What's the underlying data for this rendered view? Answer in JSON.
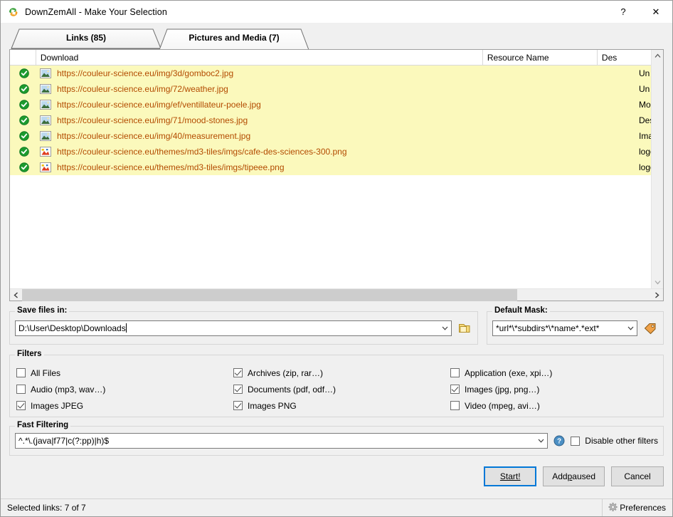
{
  "window": {
    "title": "DownZemAll - Make Your Selection",
    "app_icon": "downzemall-icon",
    "help_button": "?",
    "close_button": "✕"
  },
  "tabs": [
    {
      "label": "Links (85)",
      "name": "tab-links",
      "active": false
    },
    {
      "label": "Pictures and Media (7)",
      "name": "tab-pictures-and-media",
      "active": true
    }
  ],
  "list": {
    "columns": [
      {
        "key": "check",
        "label": ""
      },
      {
        "key": "download",
        "label": "Download"
      },
      {
        "key": "resource",
        "label": "Resource Name"
      },
      {
        "key": "description",
        "label": "Des"
      }
    ],
    "rows": [
      {
        "checked": true,
        "icon": "image-file-icon",
        "url": "https://couleur-science.eu/img/3d/gomboc2.jpg",
        "resource": "",
        "description": "Un"
      },
      {
        "checked": true,
        "icon": "image-file-icon",
        "url": "https://couleur-science.eu/img/72/weather.jpg",
        "resource": "",
        "description": "Un"
      },
      {
        "checked": true,
        "icon": "image-file-icon",
        "url": "https://couleur-science.eu/img/ef/ventillateur-poele.jpg",
        "resource": "",
        "description": "Mo"
      },
      {
        "checked": true,
        "icon": "image-file-icon",
        "url": "https://couleur-science.eu/img/71/mood-stones.jpg",
        "resource": "",
        "description": "Des"
      },
      {
        "checked": true,
        "icon": "image-file-icon",
        "url": "https://couleur-science.eu/img/40/measurement.jpg",
        "resource": "",
        "description": "Ima"
      },
      {
        "checked": true,
        "icon": "png-file-icon",
        "url": "https://couleur-science.eu/themes/md3-tiles/imgs/cafe-des-sciences-300.png",
        "resource": "",
        "description": "logo"
      },
      {
        "checked": true,
        "icon": "png-file-icon",
        "url": "https://couleur-science.eu/themes/md3-tiles/imgs/tipeee.png",
        "resource": "",
        "description": "logo"
      }
    ]
  },
  "save_files": {
    "group_title": "Save files in:",
    "path_value": "D:\\User\\Desktop\\Downloads",
    "browse_icon": "folder-icon"
  },
  "default_mask": {
    "group_title": "Default Mask:",
    "mask_value": "*url*\\*subdirs*\\*name*.*ext*",
    "tag_icon": "tag-icon"
  },
  "filters": {
    "group_title": "Filters",
    "items": [
      {
        "label": "All Files",
        "checked": false,
        "name": "filter-all-files"
      },
      {
        "label": "Archives (zip, rar…)",
        "checked": true,
        "name": "filter-archives"
      },
      {
        "label": "Application (exe, xpi…)",
        "checked": false,
        "name": "filter-application"
      },
      {
        "label": "Audio (mp3, wav…)",
        "checked": false,
        "name": "filter-audio"
      },
      {
        "label": "Documents (pdf, odf…)",
        "checked": true,
        "name": "filter-documents"
      },
      {
        "label": "Images (jpg, png…)",
        "checked": true,
        "name": "filter-images"
      },
      {
        "label": "Images JPEG",
        "checked": true,
        "name": "filter-images-jpeg"
      },
      {
        "label": "Images PNG",
        "checked": true,
        "name": "filter-images-png"
      },
      {
        "label": "Video (mpeg, avi…)",
        "checked": false,
        "name": "filter-video"
      }
    ]
  },
  "fast_filtering": {
    "group_title": "Fast Filtering",
    "regex_value": "^.*\\.(java|f77|c(?:pp)|h)$",
    "help_icon": "help-icon",
    "disable_label": "Disable other filters",
    "disable_checked": false
  },
  "buttons": {
    "start": {
      "pre": "S",
      "accel": "",
      "post": "tart!",
      "full": "Start!"
    },
    "add_paused_pre": "Add ",
    "add_paused_accel": "p",
    "add_paused_post": "aused",
    "cancel": "Cancel"
  },
  "statusbar": {
    "text": "Selected links: 7 of 7",
    "preferences_label": "Preferences",
    "preferences_icon": "gear-icon"
  },
  "colors": {
    "row_highlight": "#fbf9bc",
    "url_text": "#b34b00",
    "accent": "#0078d7",
    "check_green": "#1c9b2e"
  }
}
